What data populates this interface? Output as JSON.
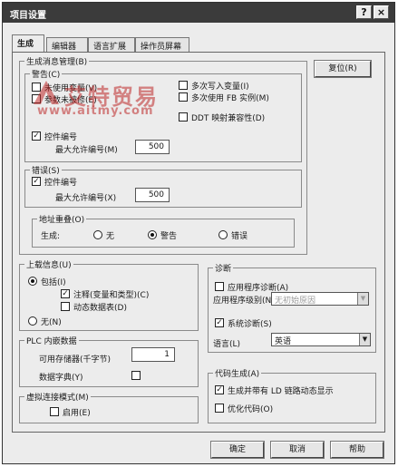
{
  "window": {
    "title": "项目设置"
  },
  "title_buttons": {
    "help": "?",
    "close": "×"
  },
  "tabs": [
    "生成",
    "编辑器",
    "语言扩展",
    "操作员屏幕"
  ],
  "msg_mgmt": {
    "title": "生成消息管理(B)",
    "reset": "复位(R)",
    "warning": {
      "title": "警告(C)",
      "unused_var": "未使用变量(V)",
      "param_modified": "参数未被修(E)",
      "multi_write": "多次写入变量(I)",
      "multi_fb": "多次使用 FB 实例(M)",
      "ddt_compat": "DDT 映射兼容性(D)",
      "control_num": "控件编号",
      "max_label": "最大允许编号(M)",
      "max_value": "500"
    },
    "error": {
      "title": "错误(S)",
      "control_num": "控件编号",
      "max_label": "最大允许编号(X)",
      "max_value": "500"
    },
    "address_overlap": {
      "title": "地址重叠(O)",
      "gen_label": "生成:",
      "none": "无",
      "warning": "警告",
      "error": "错误"
    }
  },
  "upload": {
    "title": "上载信息(U)",
    "include": "包括(I)",
    "comments": "注释(变量和类型)(C)",
    "anim_tables": "动态数据表(D)",
    "none": "无(N)"
  },
  "plc": {
    "title": "PLC 内嵌数据",
    "memory_label": "可用存储器(千字节)",
    "memory_value": "1",
    "dictionary": "数据字典(Y)"
  },
  "virtual": {
    "title": "虚拟连接模式(M)",
    "enable": "启用(E)"
  },
  "diagnostics": {
    "title": "诊断",
    "app_diag": "应用程序诊断(A)",
    "app_level": "应用程序级别(N):",
    "level_value": "无初始原因",
    "sys_diag": "系统诊断(S)",
    "language_label": "语言(L)",
    "language_value": "英语"
  },
  "codegen": {
    "title": "代码生成(A)",
    "ld_link": "生成并带有 LD 链路动态显示",
    "optimize": "优化代码(O)"
  },
  "buttons": {
    "ok": "确定",
    "cancel": "取消",
    "help": "帮助"
  },
  "watermark": {
    "brand": "艾特贸易",
    "url": "www.aitmy.com"
  },
  "colors": {
    "titlebar": "#3b3b3b",
    "watermark": "#be2828"
  }
}
